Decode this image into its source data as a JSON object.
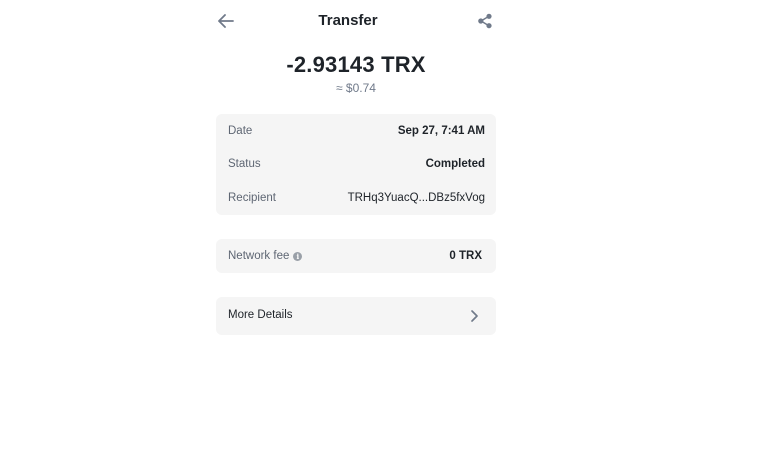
{
  "header": {
    "title": "Transfer",
    "back_icon": "arrow-left-icon",
    "share_icon": "share-icon"
  },
  "summary": {
    "amount": "-2.93143 TRX",
    "fiat": "≈ $0.74"
  },
  "details": [
    {
      "label": "Date",
      "value": "Sep 27, 7:41 AM"
    },
    {
      "label": "Status",
      "value": "Completed"
    },
    {
      "label": "Recipient",
      "value": "TRHq3YuacQ...DBz5fxVog"
    }
  ],
  "fee": {
    "label": "Network fee",
    "value": "0 TRX",
    "info_icon": "info-icon"
  },
  "more": {
    "label": "More Details",
    "chevron_icon": "chevron-right-icon"
  }
}
